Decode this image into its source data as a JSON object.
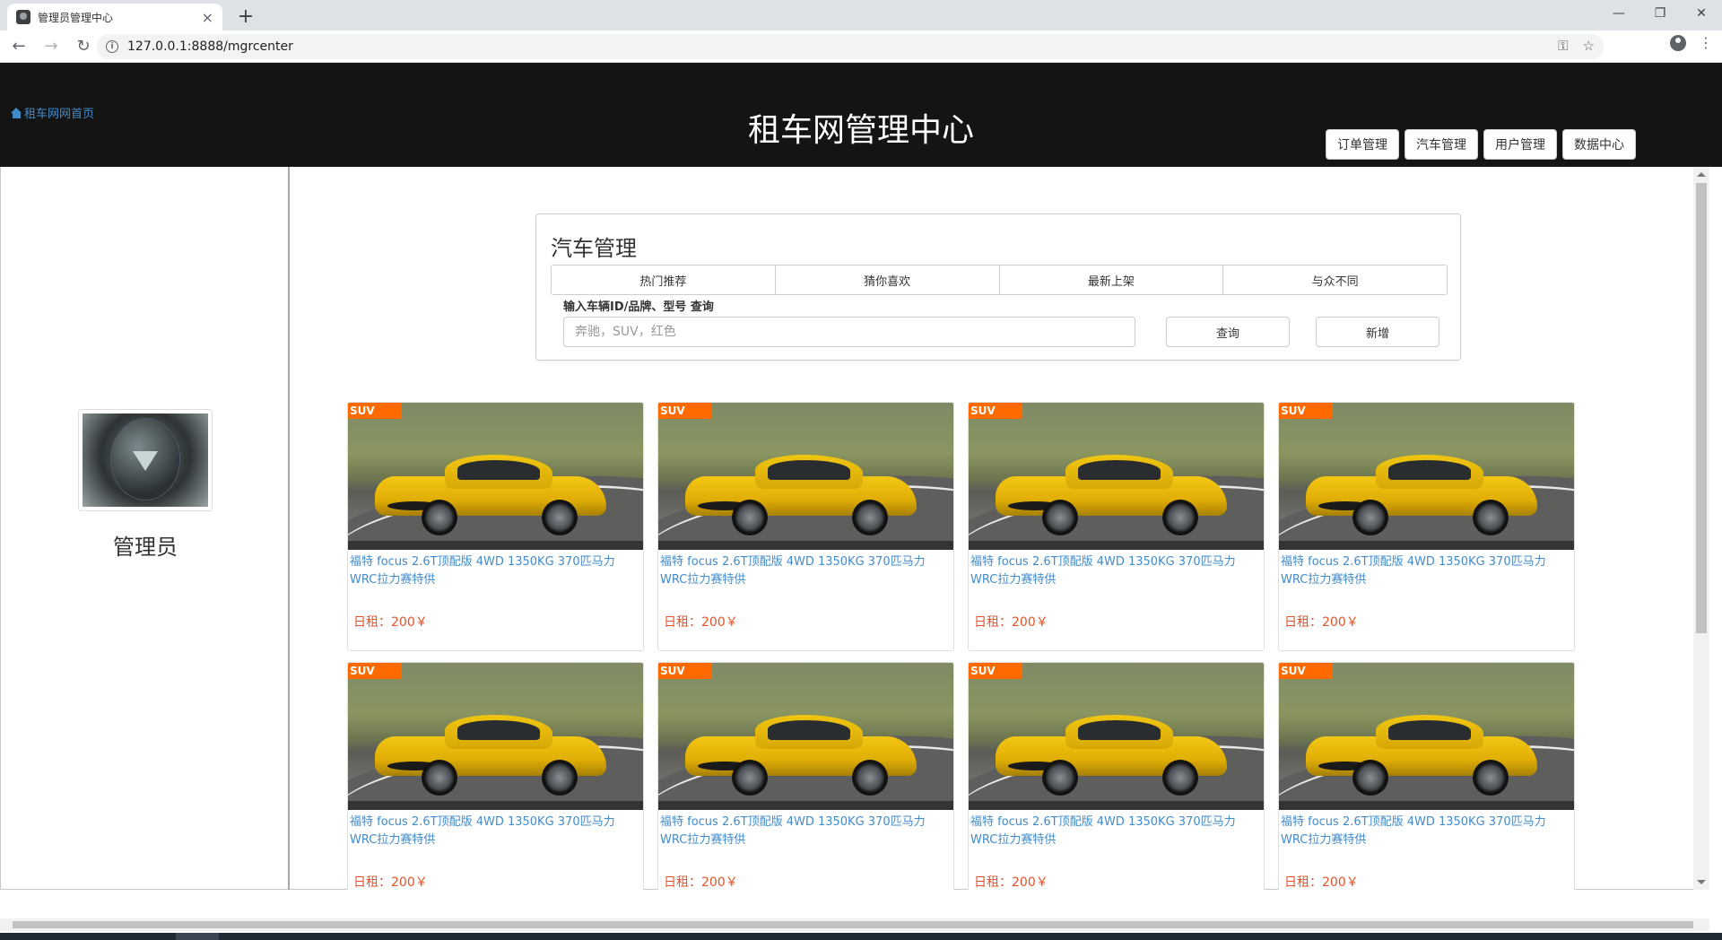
{
  "browser": {
    "tab_title": "管理员管理中心",
    "url": "127.0.0.1:8888/mgrcenter",
    "new_tab": "+",
    "close": "×",
    "minimize": "—",
    "maximize": "❐",
    "window_close": "✕"
  },
  "header": {
    "home_link": "租车网网首页",
    "title": "租车网管理中心",
    "nav": [
      "订单管理",
      "汽车管理",
      "用户管理",
      "数据中心"
    ]
  },
  "sidebar": {
    "admin_name": "管理员"
  },
  "panel": {
    "title": "汽车管理",
    "tabs": [
      "热门推荐",
      "猜你喜欢",
      "最新上架",
      "与众不同"
    ],
    "search_label": "输入车辆ID/品牌、型号 查询",
    "search_placeholder": "奔驰，SUV，红色",
    "query_button": "查询",
    "add_button": "新增"
  },
  "cars": [
    {
      "badge": "SUV",
      "name": "福特 focus 2.6T顶配版 4WD 1350KG 370匹马力WRC拉力赛特供",
      "price": "日租：200￥"
    },
    {
      "badge": "SUV",
      "name": "福特 focus 2.6T顶配版 4WD 1350KG 370匹马力WRC拉力赛特供",
      "price": "日租：200￥"
    },
    {
      "badge": "SUV",
      "name": "福特 focus 2.6T顶配版 4WD 1350KG 370匹马力WRC拉力赛特供",
      "price": "日租：200￥"
    },
    {
      "badge": "SUV",
      "name": "福特 focus 2.6T顶配版 4WD 1350KG 370匹马力WRC拉力赛特供",
      "price": "日租：200￥"
    },
    {
      "badge": "SUV",
      "name": "福特 focus 2.6T顶配版 4WD 1350KG 370匹马力WRC拉力赛特供",
      "price": "日租：200￥"
    },
    {
      "badge": "SUV",
      "name": "福特 focus 2.6T顶配版 4WD 1350KG 370匹马力WRC拉力赛特供",
      "price": "日租：200￥"
    },
    {
      "badge": "SUV",
      "name": "福特 focus 2.6T顶配版 4WD 1350KG 370匹马力WRC拉力赛特供",
      "price": "日租：200￥"
    },
    {
      "badge": "SUV",
      "name": "福特 focus 2.6T顶配版 4WD 1350KG 370匹马力WRC拉力赛特供",
      "price": "日租：200￥"
    }
  ],
  "colors": {
    "header_bg": "#141414",
    "link": "#428bca",
    "price": "#e5532a",
    "badge": "#ff6a00"
  }
}
